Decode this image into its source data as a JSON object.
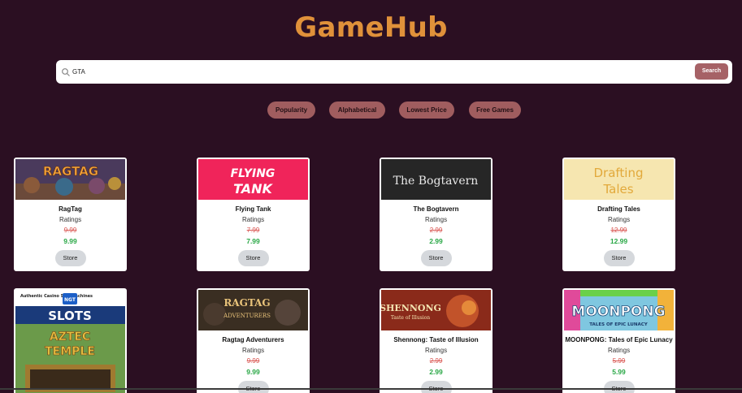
{
  "app": {
    "title": "GameHub"
  },
  "search": {
    "value": "GTA",
    "button_label": "Search"
  },
  "filters": [
    {
      "label": "Popularity"
    },
    {
      "label": "Alphabetical"
    },
    {
      "label": "Lowest Price"
    },
    {
      "label": "Free Games"
    }
  ],
  "games": [
    {
      "name": "RagTag",
      "ratings": "Ratings",
      "old_price": "9.99",
      "new_price": "9.99",
      "store_label": "Store",
      "image_text": "RAGTAG",
      "image_bg": "#4a3a5c",
      "image_fg": "#f2a23a"
    },
    {
      "name": "Flying Tank",
      "ratings": "Ratings",
      "old_price": "7.99",
      "new_price": "7.99",
      "store_label": "Store",
      "image_text": "FLYING TANK",
      "image_bg": "#f0245a",
      "image_fg": "#ffffff"
    },
    {
      "name": "The Bogtavern",
      "ratings": "Ratings",
      "old_price": "2.99",
      "new_price": "2.99",
      "store_label": "Store",
      "image_text": "The Bogtavern",
      "image_bg": "#1c1c1c",
      "image_fg": "#e8e8e8"
    },
    {
      "name": "Drafting Tales",
      "ratings": "Ratings",
      "old_price": "12.99",
      "new_price": "12.99",
      "store_label": "Store",
      "image_text": "Drafting Tales",
      "image_bg": "#f6e6b0",
      "image_fg": "#e2a93b"
    },
    {
      "name": "",
      "ratings": "",
      "old_price": "",
      "new_price": "",
      "store_label": "",
      "image_text": "SLOTS",
      "image_text_2": "AZTEC TEMPLE",
      "image_caption": "Authentic Casino Slot Machines",
      "image_badge": "NGT",
      "image_bg": "#5a8a3a",
      "image_fg": "#ffffff"
    },
    {
      "name": "Ragtag Adventurers",
      "ratings": "Ratings",
      "old_price": "9.99",
      "new_price": "9.99",
      "store_label": "Store",
      "image_text": "RAGTAG ADVENTURERS",
      "image_bg": "#3a2e22",
      "image_fg": "#e9c37a"
    },
    {
      "name": "Shennong: Taste of Illusion",
      "ratings": "Ratings",
      "old_price": "2.99",
      "new_price": "2.99",
      "store_label": "Store",
      "image_text": "SHENNONG",
      "image_text_2": "Taste of Illusion",
      "image_bg": "#8a2a1a",
      "image_fg": "#f3e3b0"
    },
    {
      "name": "MOONPONG: Tales of Epic Lunacy",
      "ratings": "Ratings",
      "old_price": "5.99",
      "new_price": "5.99",
      "store_label": "Store",
      "image_text": "MOONPONG",
      "image_text_2": "TALES OF EPIC LUNACY",
      "image_bg": "#7fc7e0",
      "image_fg": "#ffffff"
    }
  ]
}
